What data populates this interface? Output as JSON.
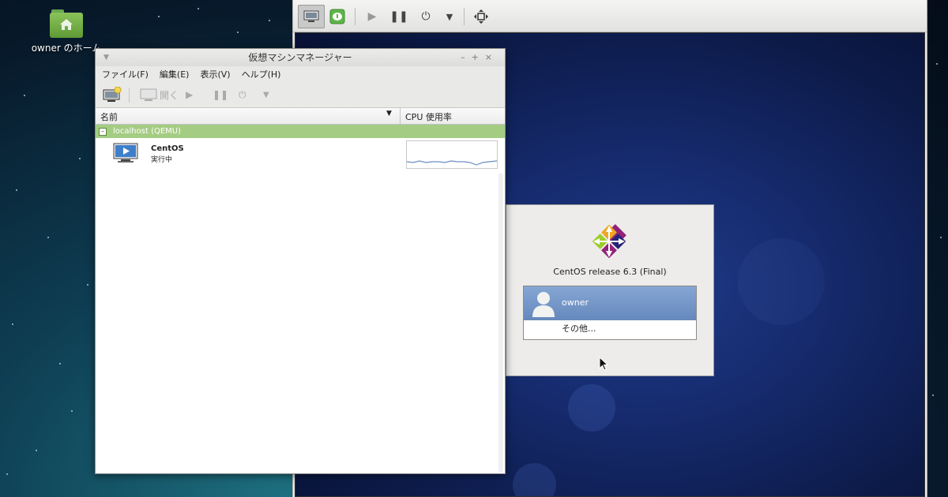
{
  "desktop": {
    "home_icon_label": "owner のホーム",
    "home_icon": "home-folder-icon"
  },
  "viewer": {
    "toolbar": {
      "console_icon": "monitor-icon",
      "details_icon": "info-icon",
      "run_icon": "play-icon",
      "pause_icon": "pause-icon",
      "power_icon": "power-icon",
      "power_menu_icon": "chevron-down-icon",
      "fullscreen_icon": "fullscreen-icon"
    },
    "guest": {
      "release_text": "CentOS release 6.3 (Final)",
      "users": [
        {
          "name": "owner",
          "selected": true
        },
        {
          "name": "その他...",
          "selected": false
        }
      ],
      "logo": "centos-logo"
    }
  },
  "manager": {
    "title": "仮想マシンマネージャー",
    "menu": [
      "ファイル(F)",
      "編集(E)",
      "表示(V)",
      "ヘルプ(H)"
    ],
    "toolbar": {
      "new_icon": "new-vm-icon",
      "open_label": "開く",
      "open_icon": "monitor-icon",
      "run_icon": "play-icon",
      "pause_icon": "pause-icon",
      "power_icon": "power-icon",
      "power_menu_icon": "chevron-down-icon"
    },
    "columns": {
      "name": "名前",
      "cpu": "CPU 使用率"
    },
    "host": {
      "label": "localhost (QEMU)",
      "expanded": true
    },
    "vms": [
      {
        "name": "CentOS",
        "status": "実行中"
      }
    ]
  },
  "colors": {
    "host_row": "#a5cc83",
    "selected_user": "#7497c8",
    "vm_desktop": "#15296a"
  }
}
